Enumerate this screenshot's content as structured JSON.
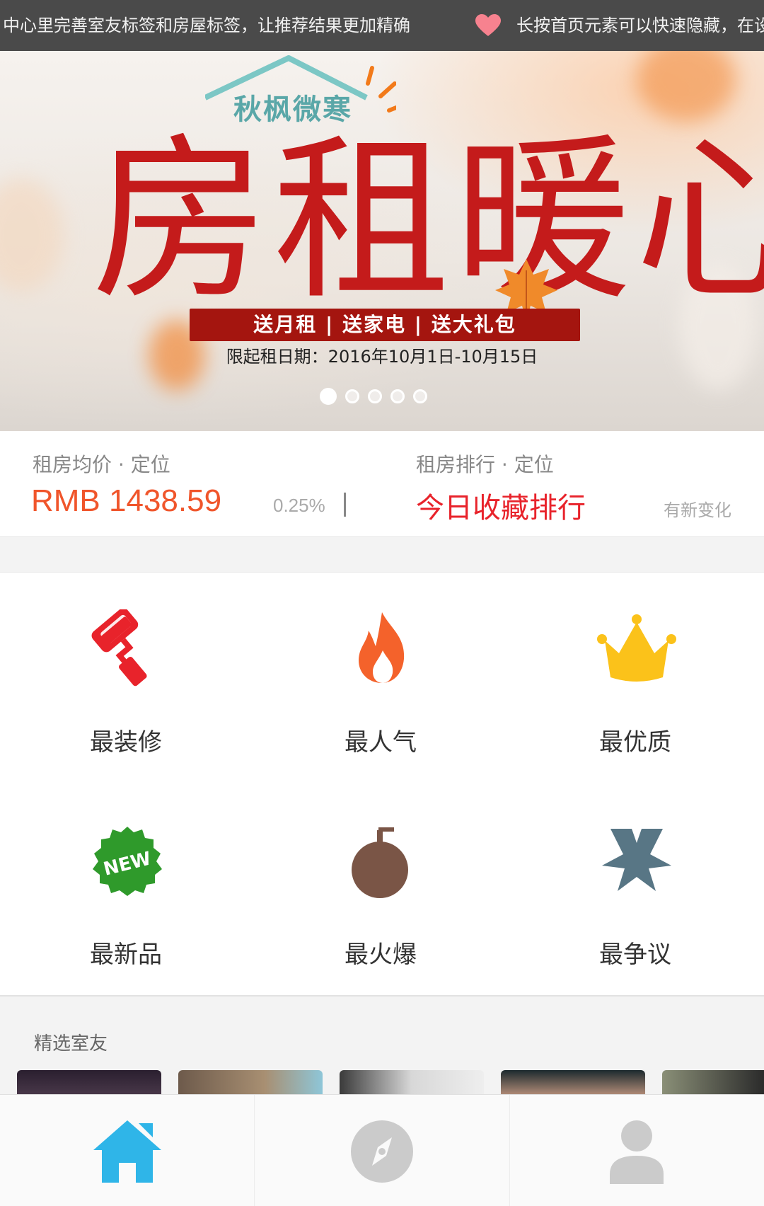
{
  "notice": {
    "text_1": "中心里完善室友标签和房屋标签，让推荐结果更加精确",
    "text_2": "长按首页元素可以快速隐藏，在设"
  },
  "banner": {
    "subtitle": "秋枫微寒",
    "title": "房租暖心",
    "ribbon": "送月租 | 送家电 | 送大礼包",
    "date": "限起租日期：2016年10月1日-10月15日",
    "slide_count": 5,
    "active_slide": 1
  },
  "stats": {
    "avg": {
      "label": "租房均价 · 定位",
      "value": "RMB 1438.59",
      "change": "0.25%"
    },
    "rank": {
      "label": "租房排行 · 定位",
      "value": "今日收藏排行",
      "hint": "有新变化"
    }
  },
  "categories": [
    {
      "label": "最装修",
      "icon": "paint-roller-icon",
      "color": "#e8232b"
    },
    {
      "label": "最人气",
      "icon": "flame-icon",
      "color": "#f4622b"
    },
    {
      "label": "最优质",
      "icon": "crown-icon",
      "color": "#fbc21a"
    },
    {
      "label": "最新品",
      "icon": "new-badge-icon",
      "color": "#2f9a2b"
    },
    {
      "label": "最火爆",
      "icon": "bomb-icon",
      "color": "#7a5546"
    },
    {
      "label": "最争议",
      "icon": "crossed-arrows-icon",
      "color": "#587685"
    }
  ],
  "featured": {
    "title": "精选室友",
    "thumb_count": 5
  },
  "tabbar": {
    "tabs": [
      {
        "icon": "home-icon",
        "active": true,
        "color": "#2fb5e8"
      },
      {
        "icon": "compass-icon",
        "active": false,
        "color": "#c9c9c9"
      },
      {
        "icon": "profile-icon",
        "active": false,
        "color": "#c9c9c9"
      }
    ]
  }
}
